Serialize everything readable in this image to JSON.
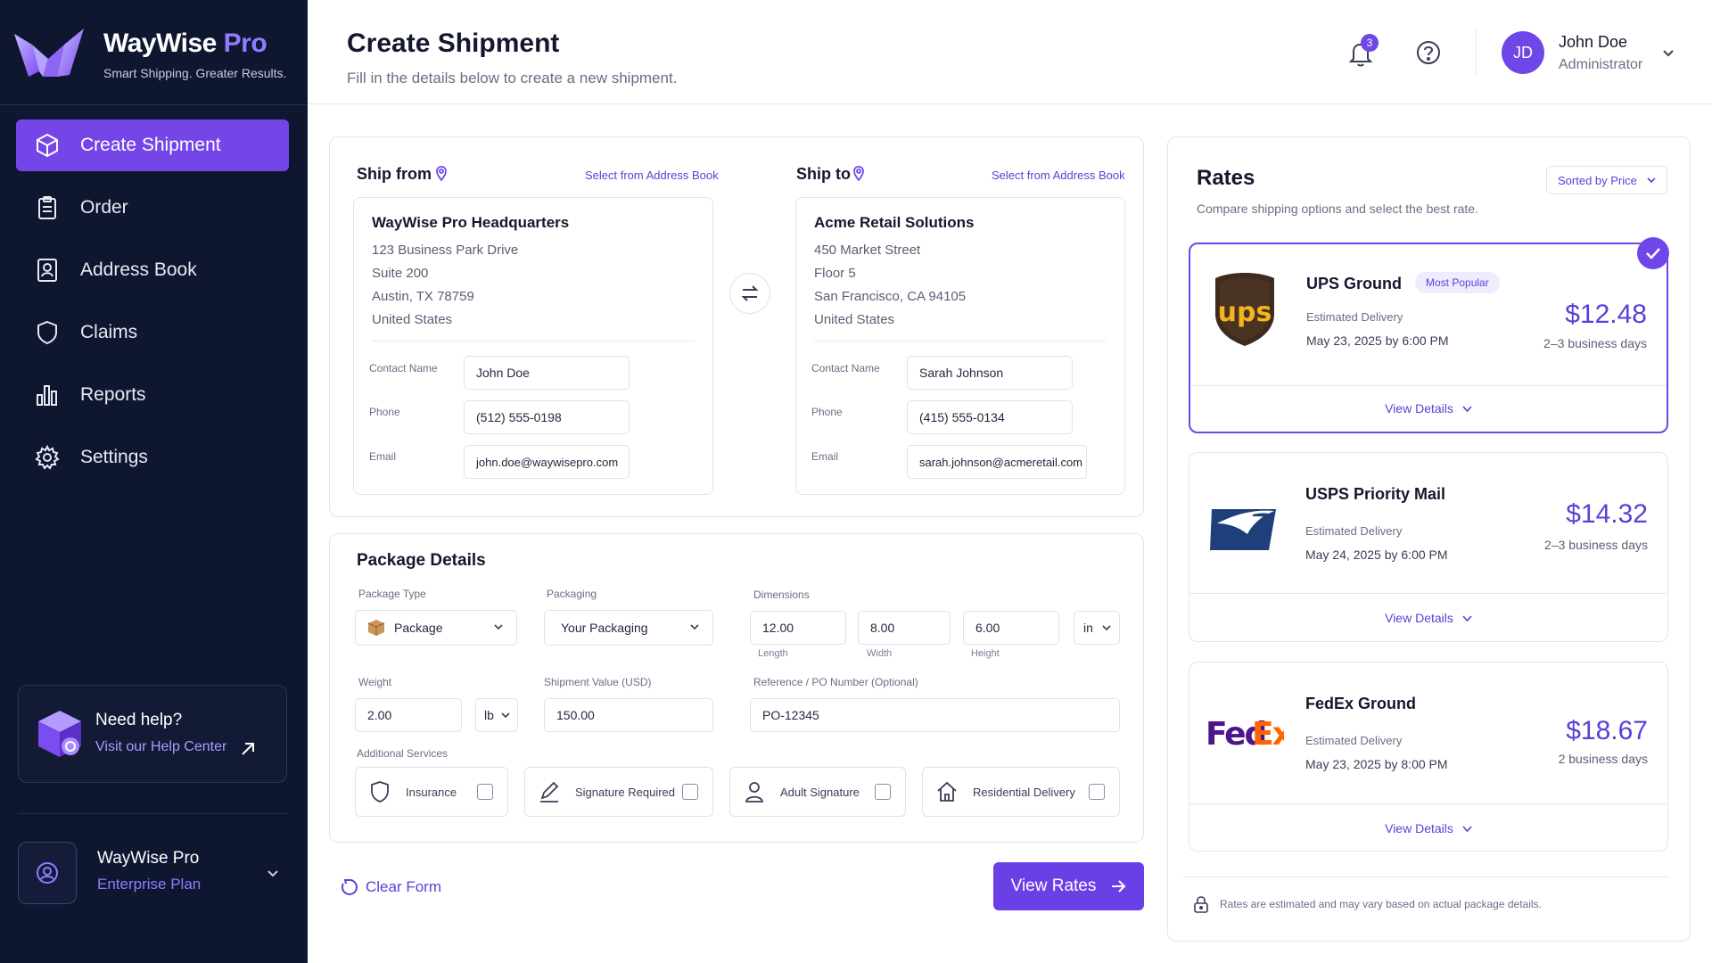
{
  "brand": {
    "name": "WayWise",
    "name_accent": "Pro",
    "tagline": "Smart Shipping. Greater Results."
  },
  "nav": [
    {
      "label": "Create Shipment",
      "icon": "box-icon",
      "active": true
    },
    {
      "label": "Order",
      "icon": "clipboard-icon"
    },
    {
      "label": "Address Book",
      "icon": "contact-book-icon"
    },
    {
      "label": "Claims",
      "icon": "shield-icon"
    },
    {
      "label": "Reports",
      "icon": "bar-chart-icon"
    },
    {
      "label": "Settings",
      "icon": "gear-icon"
    }
  ],
  "help": {
    "title": "Need help?",
    "link": "Visit our Help Center"
  },
  "plan": {
    "name": "WayWise Pro",
    "tier": "Enterprise Plan"
  },
  "header": {
    "title": "Create Shipment",
    "subtitle": "Fill in the details below to create a new shipment.",
    "notifications": "3",
    "user_initials": "JD",
    "user_name": "John Doe",
    "user_role": "Administrator"
  },
  "ship_from": {
    "label": "Ship from",
    "address_book_link": "Select from Address Book",
    "company": "WayWise Pro Headquarters",
    "lines": [
      "123 Business Park Drive",
      "Suite 200",
      "Austin, TX 78759",
      "United States"
    ],
    "contact_label": "Contact Name",
    "contact": "John Doe",
    "phone_label": "Phone",
    "phone": "(512) 555-0198",
    "email_label": "Email",
    "email": "john.doe@waywisepro.com"
  },
  "ship_to": {
    "label": "Ship to",
    "address_book_link": "Select from Address Book",
    "company": "Acme Retail Solutions",
    "lines": [
      "450 Market Street",
      "Floor 5",
      "San Francisco, CA 94105",
      "United States"
    ],
    "contact_label": "Contact Name",
    "contact": "Sarah Johnson",
    "phone_label": "Phone",
    "phone": "(415) 555-0134",
    "email_label": "Email",
    "email": "sarah.johnson@acmeretail.com"
  },
  "package": {
    "title": "Package Details",
    "type_label": "Package Type",
    "type_value": "Package",
    "packaging_label": "Packaging",
    "packaging_value": "Your Packaging",
    "dimensions_label": "Dimensions",
    "length": "12.00",
    "width": "8.00",
    "height": "6.00",
    "length_label": "Length",
    "width_label": "Width",
    "height_label": "Height",
    "dim_unit": "in",
    "weight_label": "Weight",
    "weight": "2.00",
    "weight_unit": "lb",
    "value_label": "Shipment Value (USD)",
    "value": "150.00",
    "reference_label": "Reference / PO Number (Optional)",
    "reference": "PO-12345",
    "services_label": "Additional Services",
    "services": [
      "Insurance",
      "Signature Required",
      "Adult Signature",
      "Residential Delivery"
    ]
  },
  "actions": {
    "clear": "Clear Form",
    "view_rates": "View Rates"
  },
  "rates": {
    "title": "Rates",
    "subtitle": "Compare shipping options and select the best rate.",
    "sort": "Sorted by Price",
    "est_label": "Estimated Delivery",
    "view_details": "View Details",
    "items": [
      {
        "carrier": "UPS Ground",
        "badge": "Most Popular",
        "date": "May 23, 2025 by 6:00 PM",
        "price": "$12.48",
        "days": "2–3 business days"
      },
      {
        "carrier": "USPS Priority Mail",
        "date": "May 24, 2025 by 6:00 PM",
        "price": "$14.32",
        "days": "2–3 business days"
      },
      {
        "carrier": "FedEx Ground",
        "date": "May 23, 2025 by 8:00 PM",
        "price": "$18.67",
        "days": "2 business days"
      }
    ],
    "footnote": "Rates are estimated and may vary based on actual package details."
  },
  "colors": {
    "accent": "#6f46e8",
    "sidebar": "#0f1630",
    "link": "#5b3fd6"
  }
}
